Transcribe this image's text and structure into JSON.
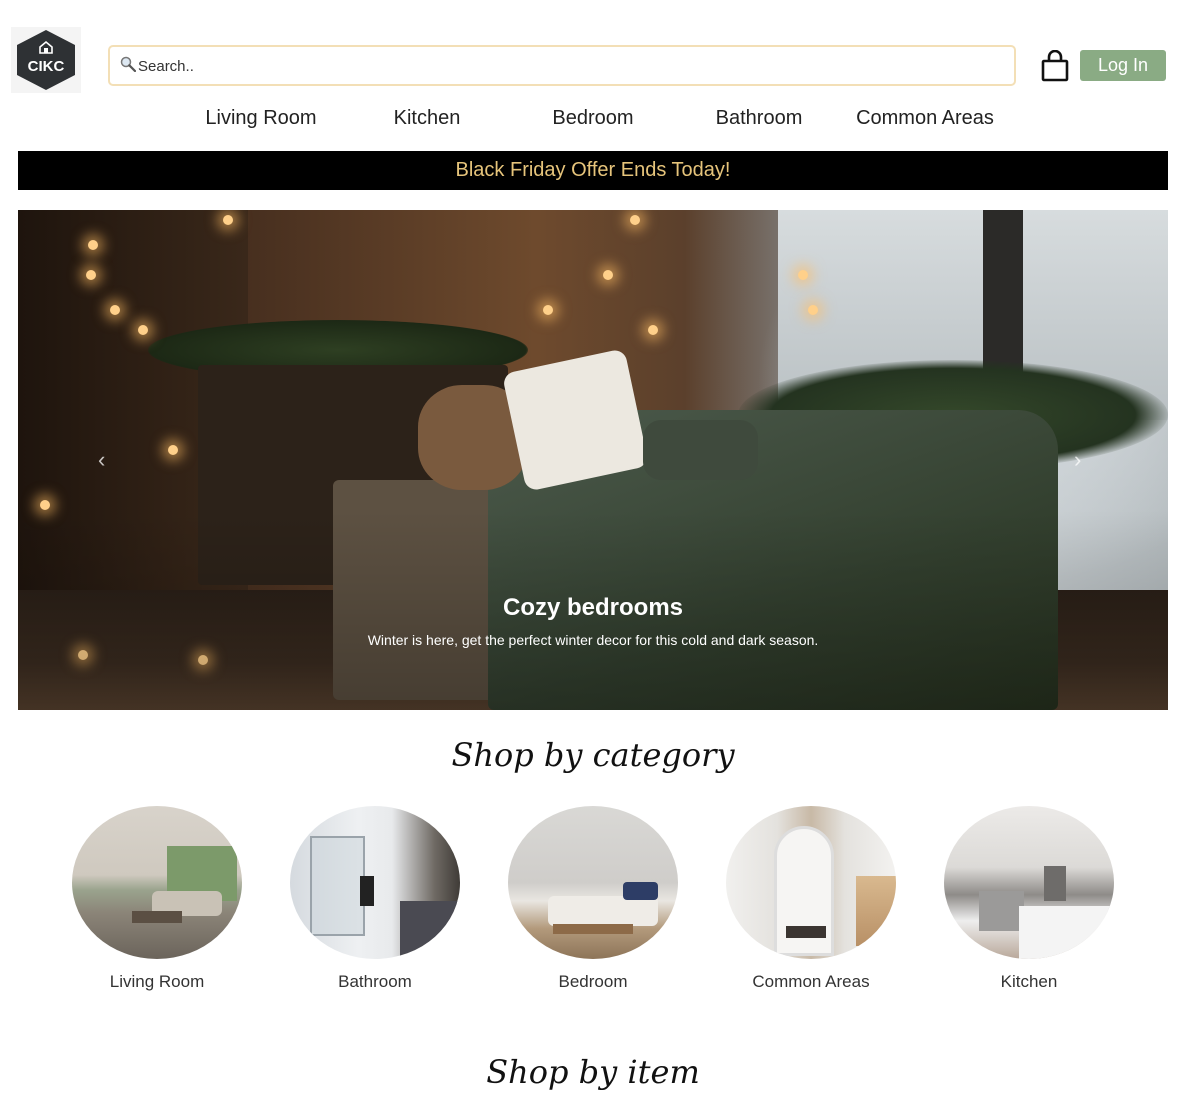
{
  "header": {
    "logo_text": "CIKC",
    "search": {
      "placeholder": "Search.."
    },
    "login_label": "Log In"
  },
  "nav": {
    "items": [
      {
        "label": "Living Room"
      },
      {
        "label": "Kitchen"
      },
      {
        "label": "Bedroom"
      },
      {
        "label": "Bathroom"
      },
      {
        "label": "Common Areas"
      }
    ]
  },
  "banner": {
    "text": "Black Friday Offer Ends Today!"
  },
  "hero": {
    "title": "Cozy bedrooms",
    "text": "Winter is here, get the perfect winter decor for this cold and dark season.",
    "prev_label": "‹",
    "next_label": "›"
  },
  "categories": {
    "title": "Shop by category",
    "items": [
      {
        "label": "Living Room"
      },
      {
        "label": "Bathroom"
      },
      {
        "label": "Bedroom"
      },
      {
        "label": "Common Areas"
      },
      {
        "label": "Kitchen"
      }
    ]
  },
  "items_section": {
    "title": "Shop by item"
  },
  "colors": {
    "login_bg": "#8aab84",
    "banner_bg": "#000000",
    "banner_text": "#e6c47b",
    "search_border": "#f3dfb6"
  },
  "icons": [
    "logo-icon",
    "search-icon",
    "shopping-bag-icon",
    "chevron-left-icon",
    "chevron-right-icon"
  ]
}
